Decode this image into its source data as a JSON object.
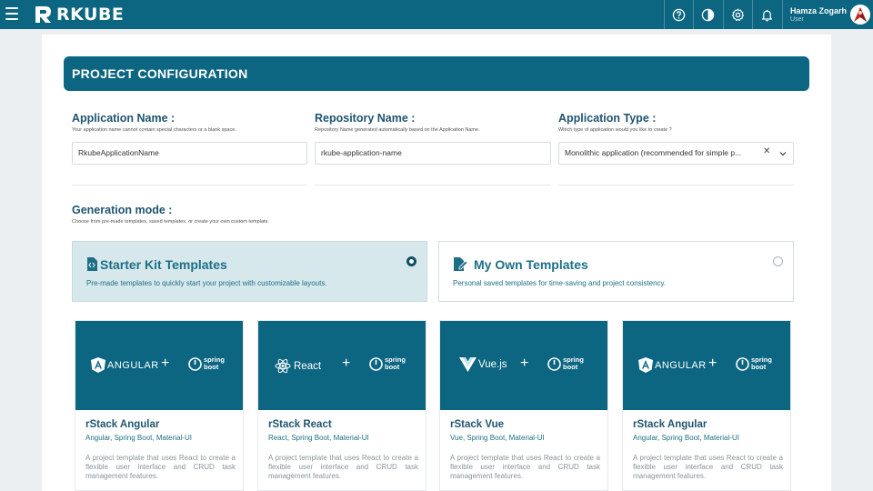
{
  "app": {
    "brand": "RKUBE",
    "user_name": "Hamza Zogarh",
    "user_role": "User"
  },
  "icons": {
    "menu": "hamburger-icon",
    "help": "help-icon",
    "theme": "contrast-icon",
    "settings": "gear-icon",
    "notifications": "bell-icon"
  },
  "colors": {
    "primary": "#0c6681",
    "selected_card": "#d6e8ec"
  },
  "page": {
    "title": "PROJECT CONFIGURATION"
  },
  "fields": {
    "app_name": {
      "label": "Application Name :",
      "help": "Your application name cannot contain special characters or a blank space.",
      "value": "RkubeApplicationName"
    },
    "repo_name": {
      "label": "Repository Name :",
      "help": "Repository Name generated automatically based on the Application Name.",
      "value": "rkube-application-name"
    },
    "app_type": {
      "label": "Application Type :",
      "help": "Which type of application would you like to create ?",
      "value": "Monolithic application (recommended for simple p...",
      "clear": "✕"
    }
  },
  "generation": {
    "title": "Generation mode :",
    "help": "Choose from pre-made templates, saved templates, or create your own custom template.",
    "modes": [
      {
        "title": "Starter Kit Templates",
        "desc": "Pre-made templates to quickly start your project with customizable layouts.",
        "selected": true
      },
      {
        "title": "My Own Templates",
        "desc": "Personal saved templates for time-saving and project consistency.",
        "selected": false
      }
    ]
  },
  "templates": [
    {
      "frontend_logo": "ANGULAR",
      "backend_logo": [
        "spring",
        "boot"
      ],
      "name": "rStack Angular",
      "stack": "Angular, Spring Boot, Material-UI",
      "desc": "A project template that uses React to create a flexible user interface and CRUD task management features."
    },
    {
      "frontend_logo": "React",
      "backend_logo": [
        "spring",
        "boot"
      ],
      "name": "rStack React",
      "stack": "React, Spring Boot, Material-UI",
      "desc": "A project template that uses React to create a flexible user interface and CRUD task management features."
    },
    {
      "frontend_logo": "Vue.js",
      "backend_logo": [
        "spring",
        "boot"
      ],
      "name": "rStack Vue",
      "stack": "Vue, Spring Boot, Material-UI",
      "desc": "A project template that uses React to create a flexible user interface and CRUD task management features."
    },
    {
      "frontend_logo": "ANGULAR",
      "backend_logo": [
        "spring",
        "boot"
      ],
      "name": "rStack Angular",
      "stack": "Angular, Spring Boot, Material-UI",
      "desc": "A project template that uses React to create a flexible user interface and CRUD task management features."
    }
  ],
  "plus_sign": "+"
}
